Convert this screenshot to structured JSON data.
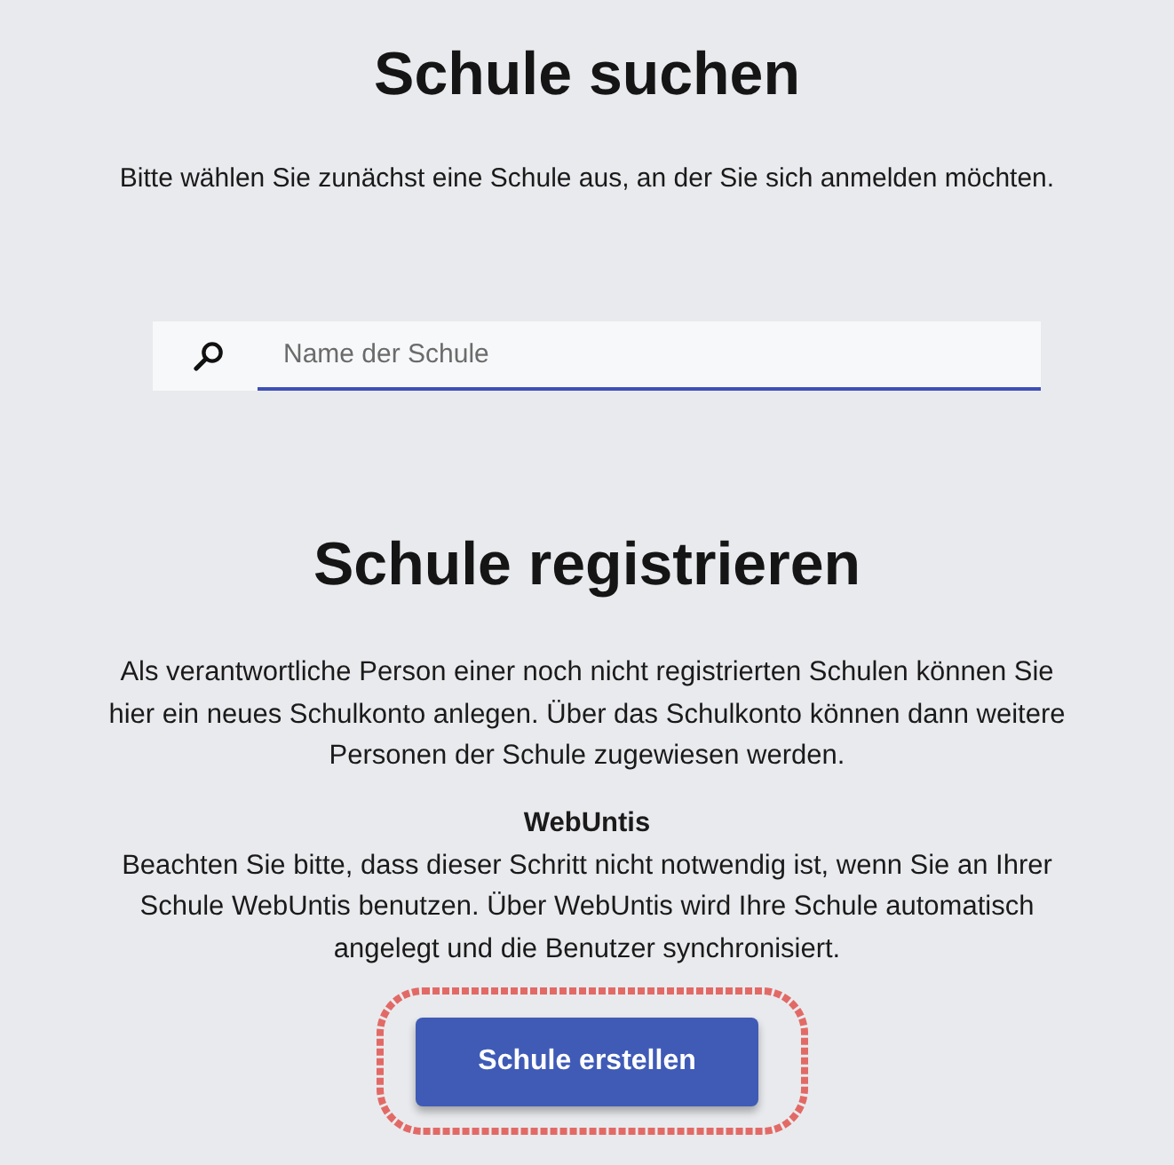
{
  "search_section": {
    "title": "Schule suchen",
    "instruction": "Bitte wählen Sie zunächst eine Schule aus, an der Sie sich anmelden möchten.",
    "search": {
      "placeholder": "Name der Schule"
    }
  },
  "register_section": {
    "title": "Schule registrieren",
    "description": "Als verantwortliche Person einer noch nicht registrierten Schulen können Sie hier ein neues Schulkonto anlegen. Über das Schulkonto können dann weitere Personen der Schule zugewiesen werden.",
    "note": {
      "title": "WebUntis",
      "text": "Beachten Sie bitte, dass dieser Schritt nicht notwendig ist, wenn Sie an Ihrer Schule WebUntis benutzen. Über WebUntis wird Ihre Schule automatisch angelegt und die Benutzer synchronisiert."
    },
    "button": "Schule erstellen"
  }
}
